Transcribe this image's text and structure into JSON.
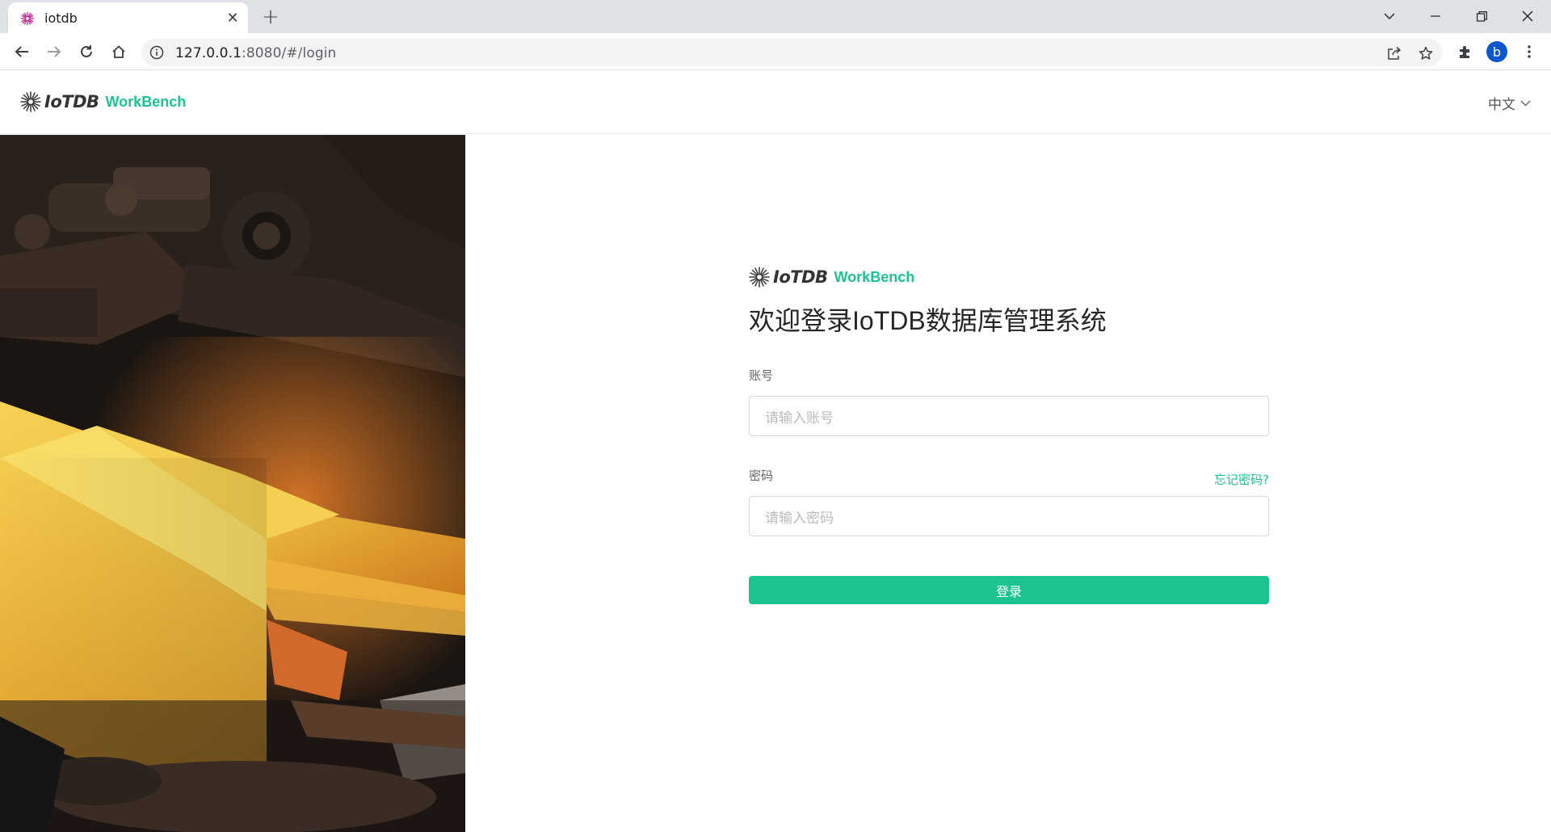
{
  "browser": {
    "tab_title": "iotdb",
    "url_host": "127.0.0.1",
    "url_rest": ":8080/#/login",
    "profile_initial": "b"
  },
  "header": {
    "logo_text": "IoTDB",
    "product_name": "WorkBench",
    "language": "中文"
  },
  "login": {
    "logo_text": "IoTDB",
    "product_name": "WorkBench",
    "title": "欢迎登录IoTDB数据库管理系统",
    "account_label": "账号",
    "account_placeholder": "请输入账号",
    "password_label": "密码",
    "password_placeholder": "请输入密码",
    "forgot_password": "忘记密码?",
    "submit_label": "登录"
  },
  "colors": {
    "brand_accent": "#1cc391",
    "tab_strip": "#dee1e6",
    "avatar": "#0b57d0"
  }
}
